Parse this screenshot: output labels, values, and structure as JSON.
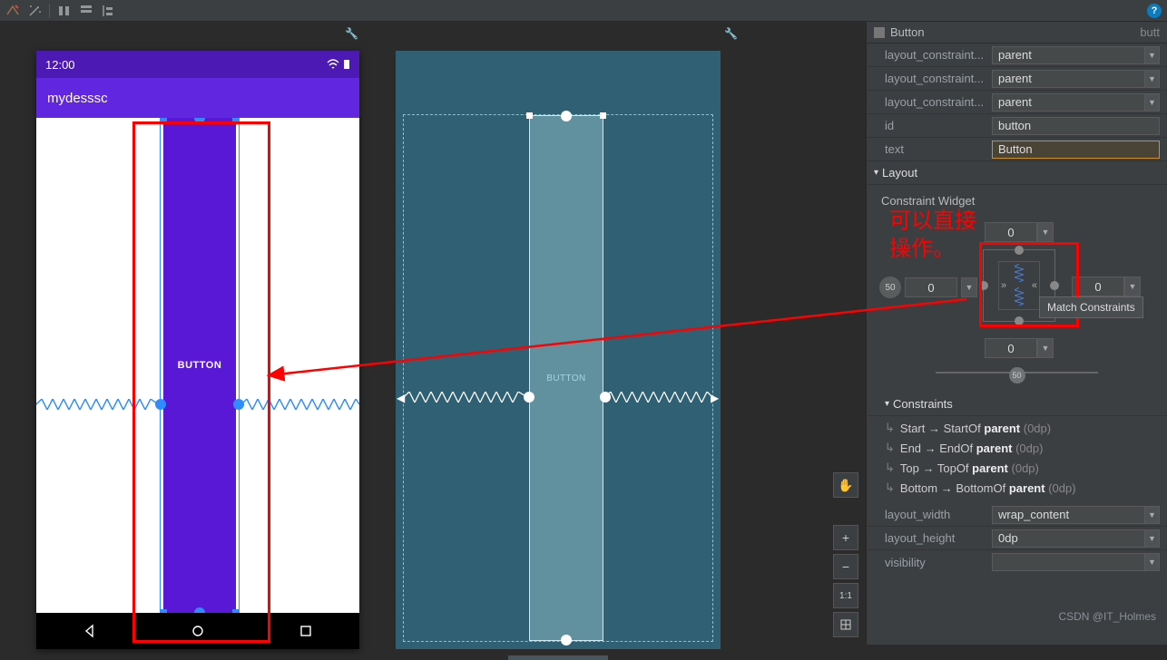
{
  "toolbar": {
    "help_glyph": "?"
  },
  "phone": {
    "time": "12:00",
    "app_title": "mydesssc",
    "button_text": "BUTTON"
  },
  "blueprint": {
    "button_text": "BUTTON"
  },
  "zoom": {
    "pan_glyph": "✋",
    "plus": "+",
    "minus": "−",
    "one_to_one": "1:1"
  },
  "panel": {
    "component_name": "Button",
    "component_type": "butt",
    "attrs": {
      "constraint_left_label": "layout_constraint...",
      "constraint_left_val": "parent",
      "constraint_right_label": "layout_constraint...",
      "constraint_right_val": "parent",
      "constraint_top_label": "layout_constraint...",
      "constraint_top_val": "parent",
      "id_label": "id",
      "id_val": "button",
      "text_label": "text",
      "text_val": "Button"
    },
    "layout_header": "Layout",
    "cw_title": "Constraint Widget",
    "cw": {
      "top_margin": "0",
      "left_margin": "0",
      "right_margin": "0",
      "bottom_margin": "0",
      "bias_h": "50",
      "bias_v": "50"
    },
    "tooltip": "Match Constraints",
    "constraints_hdr": "Constraints",
    "constraints": [
      {
        "side": "Start",
        "rel": "StartOf",
        "target": "parent",
        "dp": "(0dp)"
      },
      {
        "side": "End",
        "rel": "EndOf",
        "target": "parent",
        "dp": "(0dp)"
      },
      {
        "side": "Top",
        "rel": "TopOf",
        "target": "parent",
        "dp": "(0dp)"
      },
      {
        "side": "Bottom",
        "rel": "BottomOf",
        "target": "parent",
        "dp": "(0dp)"
      }
    ],
    "layout_width_label": "layout_width",
    "layout_width_val": "wrap_content",
    "layout_height_label": "layout_height",
    "layout_height_val": "0dp",
    "visibility_label": "visibility"
  },
  "annotation": {
    "line1": "可以直接",
    "line2": "操作。"
  },
  "watermark": "CSDN @IT_Holmes"
}
